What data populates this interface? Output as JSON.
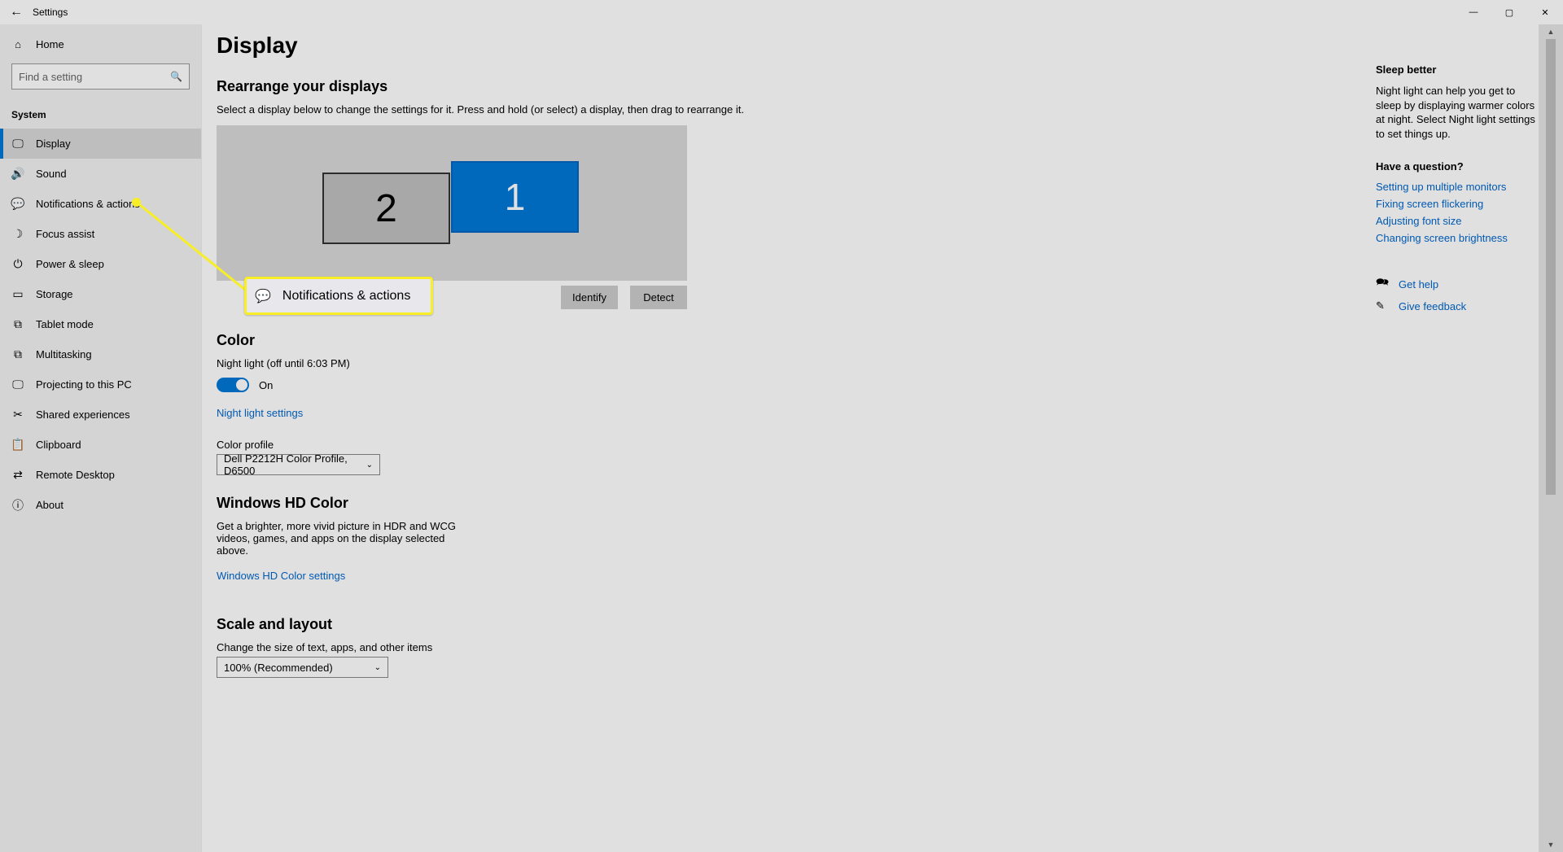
{
  "app_title": "Settings",
  "window": {
    "min": "—",
    "max": "▢",
    "close": "✕"
  },
  "home_label": "Home",
  "search_placeholder": "Find a setting",
  "group_label": "System",
  "nav": [
    {
      "icon": "🖵",
      "label": "Display"
    },
    {
      "icon": "🔊",
      "label": "Sound"
    },
    {
      "icon": "💬",
      "label": "Notifications & actions"
    },
    {
      "icon": "☽",
      "label": "Focus assist"
    },
    {
      "icon": "⏻",
      "label": "Power & sleep"
    },
    {
      "icon": "▭",
      "label": "Storage"
    },
    {
      "icon": "⧉",
      "label": "Tablet mode"
    },
    {
      "icon": "⧉",
      "label": "Multitasking"
    },
    {
      "icon": "🖵",
      "label": "Projecting to this PC"
    },
    {
      "icon": "✂",
      "label": "Shared experiences"
    },
    {
      "icon": "📋",
      "label": "Clipboard"
    },
    {
      "icon": "⇄",
      "label": "Remote Desktop"
    },
    {
      "icon": "ⓘ",
      "label": "About"
    }
  ],
  "page": {
    "h1": "Display",
    "rearrange_h": "Rearrange your displays",
    "rearrange_desc": "Select a display below to change the settings for it. Press and hold (or select) a display, then drag to rearrange it.",
    "mon1": "1",
    "mon2": "2",
    "identify": "Identify",
    "detect": "Detect",
    "color_h": "Color",
    "night_light": "Night light (off until 6:03 PM)",
    "toggle_state": "On",
    "night_light_link": "Night light settings",
    "color_profile_label": "Color profile",
    "color_profile_value": "Dell P2212H Color Profile, D6500",
    "hd_h": "Windows HD Color",
    "hd_desc": "Get a brighter, more vivid picture in HDR and WCG videos, games, and apps on the display selected above.",
    "hd_link": "Windows HD Color settings",
    "scale_h": "Scale and layout",
    "scale_desc": "Change the size of text, apps, and other items",
    "scale_value": "100% (Recommended)"
  },
  "right": {
    "sleep_h": "Sleep better",
    "sleep_p": "Night light can help you get to sleep by displaying warmer colors at night. Select Night light settings to set things up.",
    "q_h": "Have a question?",
    "links": [
      "Setting up multiple monitors",
      "Fixing screen flickering",
      "Adjusting font size",
      "Changing screen brightness"
    ],
    "get_help": "Get help",
    "give_feedback": "Give feedback"
  },
  "callout_label": "Notifications & actions"
}
